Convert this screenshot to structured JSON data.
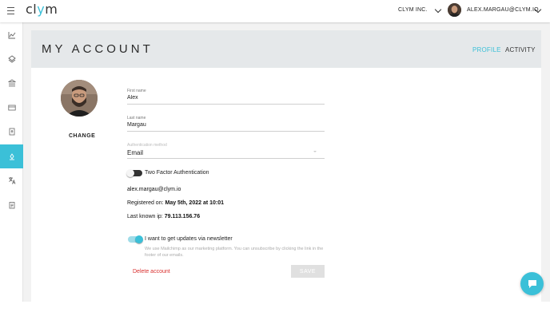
{
  "app": {
    "logo_main": "cl",
    "logo_accent": "y",
    "logo_tail": "m"
  },
  "topbar": {
    "organization": "CLYM INC.",
    "user_email": "ALEX.MARGAU@CLYM.IO"
  },
  "sidebar": {
    "items": [
      {
        "icon": "chart-icon",
        "active": false
      },
      {
        "icon": "layers-icon",
        "active": false
      },
      {
        "icon": "bank-icon",
        "active": false
      },
      {
        "icon": "credit-card-icon",
        "active": false
      },
      {
        "icon": "document-upload-icon",
        "active": false
      },
      {
        "icon": "user-icon",
        "active": true
      },
      {
        "icon": "translate-icon",
        "active": false
      },
      {
        "icon": "clipboard-icon",
        "active": false
      }
    ]
  },
  "page": {
    "title": "MY ACCOUNT",
    "tabs": {
      "profile": "PROFILE",
      "activity": "ACTIVITY"
    }
  },
  "profile": {
    "change_label": "CHANGE",
    "first_name": {
      "label": "First name",
      "value": "Alex"
    },
    "last_name": {
      "label": "Last name",
      "value": "Margau"
    },
    "auth_method": {
      "label": "Authentication method",
      "value": "Email"
    },
    "two_factor": {
      "label": "Two Factor Authentication",
      "enabled": false
    },
    "email": "alex.margau@clym.io",
    "registered_prefix": "Registered on:",
    "registered_value": "May 5th, 2022 at 10:01",
    "ip_prefix": "Last known ip:",
    "ip_value": "79.113.156.76",
    "newsletter": {
      "label": "I want to get updates via newsletter",
      "enabled": true,
      "help": "We use Mailchimp as our marketing platform. You can unsubscribe by clicking the link in the footer of our emails."
    },
    "delete_label": "Delete account",
    "save_label": "SAVE"
  },
  "colors": {
    "accent": "#3bc0d8",
    "danger": "#d9302f",
    "header_bg": "#e5e8ea"
  }
}
